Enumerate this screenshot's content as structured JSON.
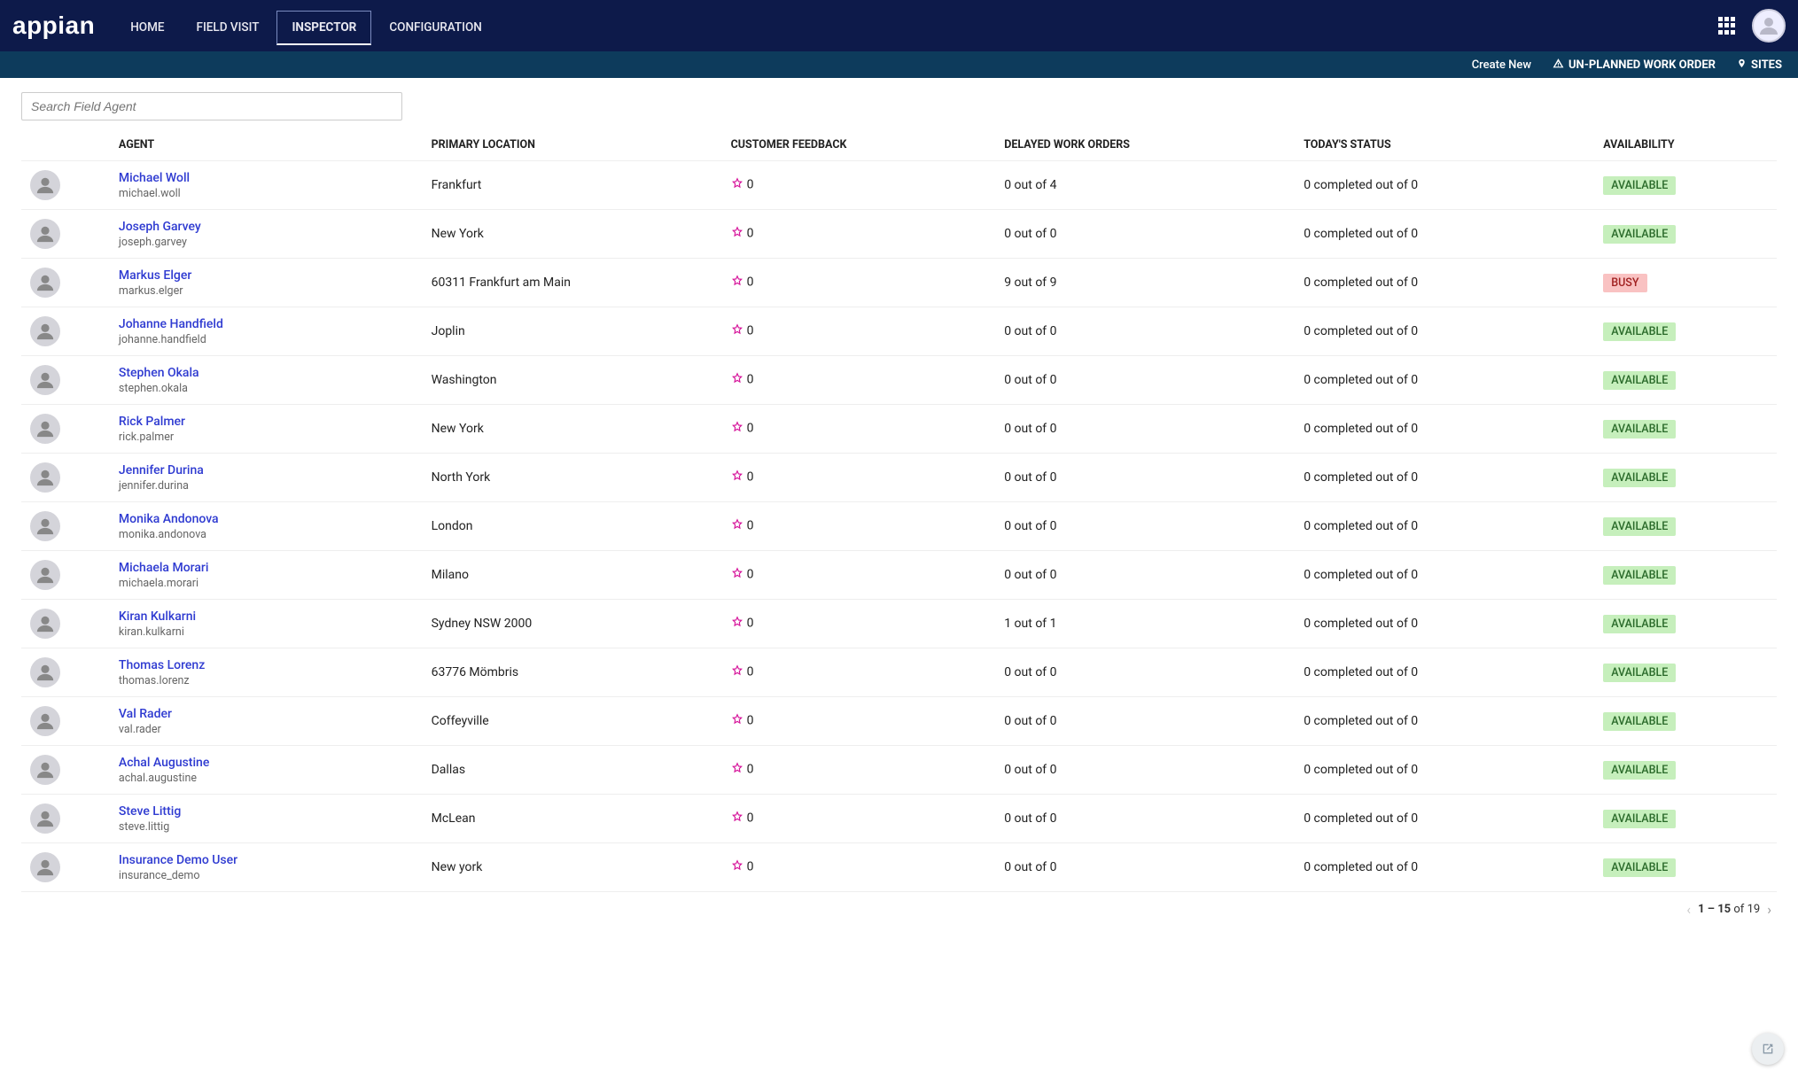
{
  "brand": "appian",
  "nav": {
    "items": [
      "HOME",
      "FIELD VISIT",
      "INSPECTOR",
      "CONFIGURATION"
    ],
    "active_index": 2
  },
  "subnav": {
    "create_new": "Create New",
    "unplanned": "UN-PLANNED WORK ORDER",
    "sites": "SITES"
  },
  "search": {
    "placeholder": "Search Field Agent"
  },
  "columns": {
    "agent": "AGENT",
    "location": "PRIMARY LOCATION",
    "feedback": "CUSTOMER FEEDBACK",
    "delayed": "DELAYED WORK ORDERS",
    "status": "TODAY'S STATUS",
    "availability": "AVAILABILITY"
  },
  "availability_labels": {
    "available": "AVAILABLE",
    "busy": "BUSY"
  },
  "rows": [
    {
      "name": "Michael Woll",
      "user": "michael.woll",
      "location": "Frankfurt",
      "feedback": "0",
      "delayed": "0 out of 4",
      "status": "0 completed out of 0",
      "availability": "available"
    },
    {
      "name": "Joseph Garvey",
      "user": "joseph.garvey",
      "location": "New York",
      "feedback": "0",
      "delayed": "0 out of 0",
      "status": "0 completed out of 0",
      "availability": "available"
    },
    {
      "name": "Markus Elger",
      "user": "markus.elger",
      "location": "60311 Frankfurt am Main",
      "feedback": "0",
      "delayed": "9 out of 9",
      "status": "0 completed out of 0",
      "availability": "busy"
    },
    {
      "name": "Johanne Handfield",
      "user": "johanne.handfield",
      "location": "Joplin",
      "feedback": "0",
      "delayed": "0 out of 0",
      "status": "0 completed out of 0",
      "availability": "available"
    },
    {
      "name": "Stephen Okala",
      "user": "stephen.okala",
      "location": "Washington",
      "feedback": "0",
      "delayed": "0 out of 0",
      "status": "0 completed out of 0",
      "availability": "available"
    },
    {
      "name": "Rick Palmer",
      "user": "rick.palmer",
      "location": "New York",
      "feedback": "0",
      "delayed": "0 out of 0",
      "status": "0 completed out of 0",
      "availability": "available"
    },
    {
      "name": "Jennifer Durina",
      "user": "jennifer.durina",
      "location": "North York",
      "feedback": "0",
      "delayed": "0 out of 0",
      "status": "0 completed out of 0",
      "availability": "available"
    },
    {
      "name": "Monika Andonova",
      "user": "monika.andonova",
      "location": "London",
      "feedback": "0",
      "delayed": "0 out of 0",
      "status": "0 completed out of 0",
      "availability": "available"
    },
    {
      "name": "Michaela Morari",
      "user": "michaela.morari",
      "location": "Milano",
      "feedback": "0",
      "delayed": "0 out of 0",
      "status": "0 completed out of 0",
      "availability": "available"
    },
    {
      "name": "Kiran Kulkarni",
      "user": "kiran.kulkarni",
      "location": "Sydney NSW 2000",
      "feedback": "0",
      "delayed": "1 out of 1",
      "status": "0 completed out of 0",
      "availability": "available"
    },
    {
      "name": "Thomas Lorenz",
      "user": "thomas.lorenz",
      "location": "63776 Mömbris",
      "feedback": "0",
      "delayed": "0 out of 0",
      "status": "0 completed out of 0",
      "availability": "available"
    },
    {
      "name": "Val Rader",
      "user": "val.rader",
      "location": "Coffeyville",
      "feedback": "0",
      "delayed": "0 out of 0",
      "status": "0 completed out of 0",
      "availability": "available"
    },
    {
      "name": "Achal Augustine",
      "user": "achal.augustine",
      "location": "Dallas",
      "feedback": "0",
      "delayed": "0 out of 0",
      "status": "0 completed out of 0",
      "availability": "available"
    },
    {
      "name": "Steve Littig",
      "user": "steve.littig",
      "location": "McLean",
      "feedback": "0",
      "delayed": "0 out of 0",
      "status": "0 completed out of 0",
      "availability": "available"
    },
    {
      "name": "Insurance Demo User",
      "user": "insurance_demo",
      "location": "New york",
      "feedback": "0",
      "delayed": "0 out of 0",
      "status": "0 completed out of 0",
      "availability": "available"
    }
  ],
  "pager": {
    "range": "1 – 15",
    "of_label": "of",
    "total": "19"
  }
}
